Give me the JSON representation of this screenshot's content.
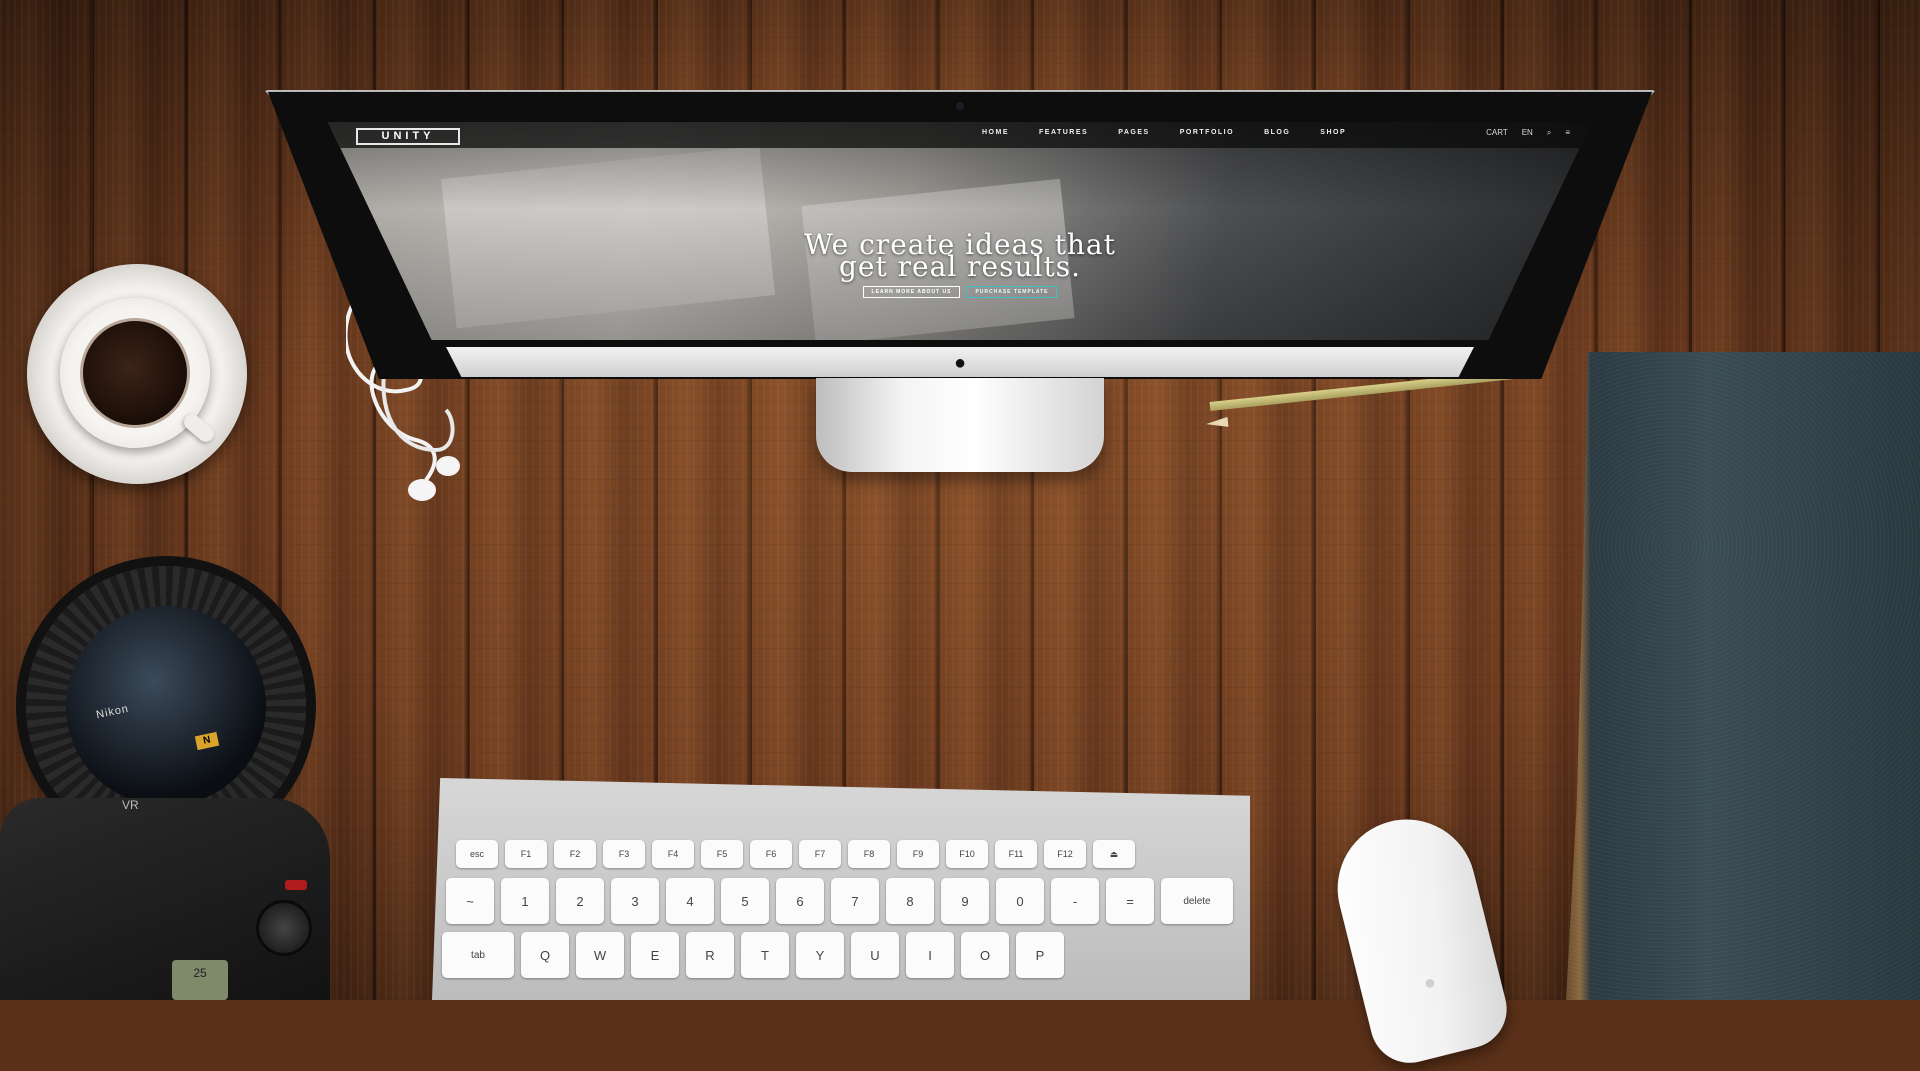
{
  "website": {
    "logo": "UNITY",
    "nav": [
      "HOME",
      "FEATURES",
      "PAGES",
      "PORTFOLIO",
      "BLOG",
      "SHOP"
    ],
    "tools": [
      "CART",
      "EN"
    ],
    "hero_title_line1": "We create ideas that",
    "hero_title_line2": "get real results.",
    "button_learn_more": "LEARN MORE ABOUT US",
    "button_purchase": "PURCHASE TEMPLATE"
  },
  "camera": {
    "brand": "Nikon",
    "badge": "N",
    "vr_label": "VR",
    "display_value": "25"
  },
  "keyboard": {
    "function_row": [
      "esc",
      "F1",
      "F2",
      "F3",
      "F4",
      "F5",
      "F6",
      "F7",
      "F8",
      "F9",
      "F10",
      "F11",
      "F12",
      "⏏"
    ],
    "number_row": [
      "~",
      "1",
      "2",
      "3",
      "4",
      "5",
      "6",
      "7",
      "8",
      "9",
      "0",
      "-",
      "=",
      "delete"
    ],
    "letter_row": [
      "tab",
      "Q",
      "W",
      "E",
      "R",
      "T",
      "Y",
      "U",
      "I",
      "O",
      "P"
    ]
  },
  "colors": {
    "wood": "#6b3a1d",
    "accent_button": "#3ac1c9"
  }
}
